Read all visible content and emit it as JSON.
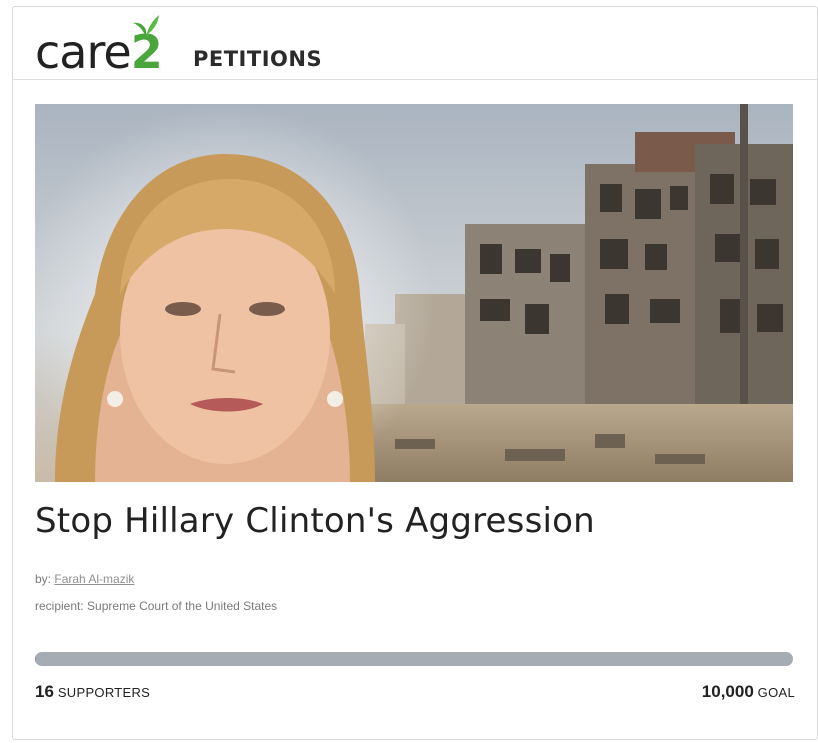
{
  "header": {
    "logo": {
      "word": "care",
      "number": "2",
      "leaf_icon": "leaf-icon"
    },
    "section_label": "PETITIONS"
  },
  "petition": {
    "image_alt": "petition-hero-image",
    "title": "Stop Hillary Clinton's Aggression",
    "by_prefix": "by:",
    "author": "Farah Al-mazik",
    "recipient_prefix": "recipient:",
    "recipient": "Supreme Court of the United States"
  },
  "progress": {
    "supporters_count": "16",
    "supporters_label": "SUPPORTERS",
    "goal_count": "10,000",
    "goal_label": "GOAL",
    "fraction": 0.0016
  },
  "colors": {
    "brand_green": "#4aa63b",
    "text_dark": "#222222",
    "progress_track": "#a5acb4"
  }
}
